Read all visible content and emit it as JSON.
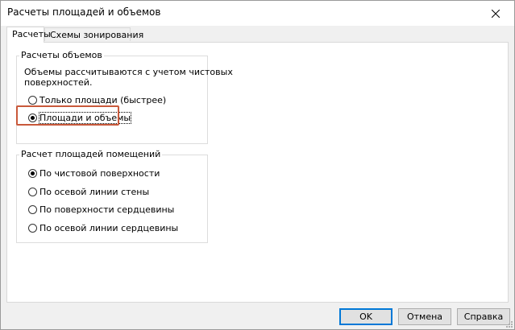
{
  "window": {
    "title": "Расчеты площадей и объемов"
  },
  "icons": {
    "close": "close-icon",
    "grip": "resize-grip-icon"
  },
  "tabs": [
    {
      "label": "Расчеты",
      "active": true
    },
    {
      "label": "Схемы зонирования",
      "active": false
    }
  ],
  "volume_group": {
    "title": "Расчеты объемов",
    "description_line1": "Объемы рассчитываются с учетом чистовых",
    "description_line2": "поверхностей.",
    "options": [
      {
        "label": "Только площади (быстрее)",
        "checked": false
      },
      {
        "label": "Площади и объемы",
        "checked": true
      }
    ]
  },
  "area_group": {
    "title": "Расчет площадей помещений",
    "options": [
      {
        "label": "По чистовой поверхности",
        "checked": true
      },
      {
        "label": "По осевой линии стены",
        "checked": false
      },
      {
        "label": "По поверхности сердцевины",
        "checked": false
      },
      {
        "label": "По осевой линии сердцевины",
        "checked": false
      }
    ]
  },
  "buttons": {
    "ok": "OK",
    "cancel": "Отмена",
    "help": "Справка"
  },
  "colors": {
    "highlight": "#c9593b",
    "default_button_border": "#0078d7"
  }
}
